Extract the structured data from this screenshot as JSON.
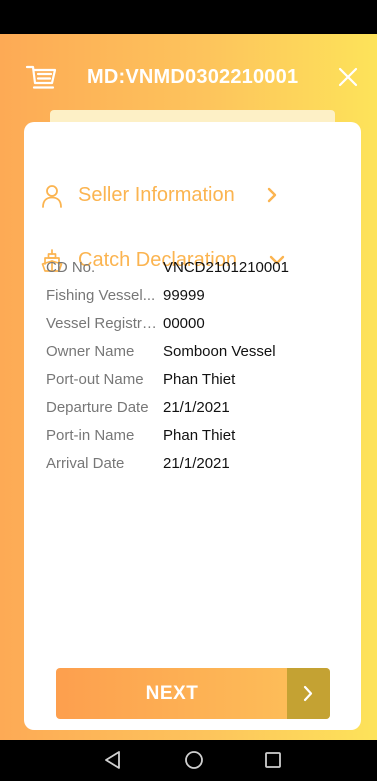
{
  "header": {
    "title": "MD:VNMD0302210001",
    "cart_icon": "cart-icon",
    "close_icon": "close-icon"
  },
  "sections": [
    {
      "label": "Seller Information",
      "icon": "person-icon",
      "chevron": "chevron-right-icon",
      "expanded": false
    },
    {
      "label": "Catch Declaration",
      "icon": "ship-icon",
      "chevron": "chevron-down-icon",
      "expanded": true
    }
  ],
  "fields": [
    {
      "label": "CD No.",
      "value": "VNCD2101210001"
    },
    {
      "label": "Fishing Vessel...",
      "value": "99999"
    },
    {
      "label": "Vessel Registra...",
      "value": "00000"
    },
    {
      "label": "Owner Name",
      "value": "Somboon Vessel"
    },
    {
      "label": "Port-out Name",
      "value": "Phan Thiet"
    },
    {
      "label": "Departure Date",
      "value": "21/1/2021"
    },
    {
      "label": "Port-in Name",
      "value": "Phan Thiet"
    },
    {
      "label": "Arrival Date",
      "value": "21/1/2021"
    }
  ],
  "next_button": {
    "label": "NEXT",
    "icon": "chevron-right-icon"
  },
  "nav_bar": {
    "back_icon": "back-triangle-icon",
    "home_icon": "home-circle-icon",
    "recents_icon": "recents-square-icon"
  },
  "colors": {
    "accent": "#fbb450",
    "gradient_start": "#fdaa55",
    "gradient_end": "#fde35a",
    "arrow_box": "#c4a233"
  }
}
